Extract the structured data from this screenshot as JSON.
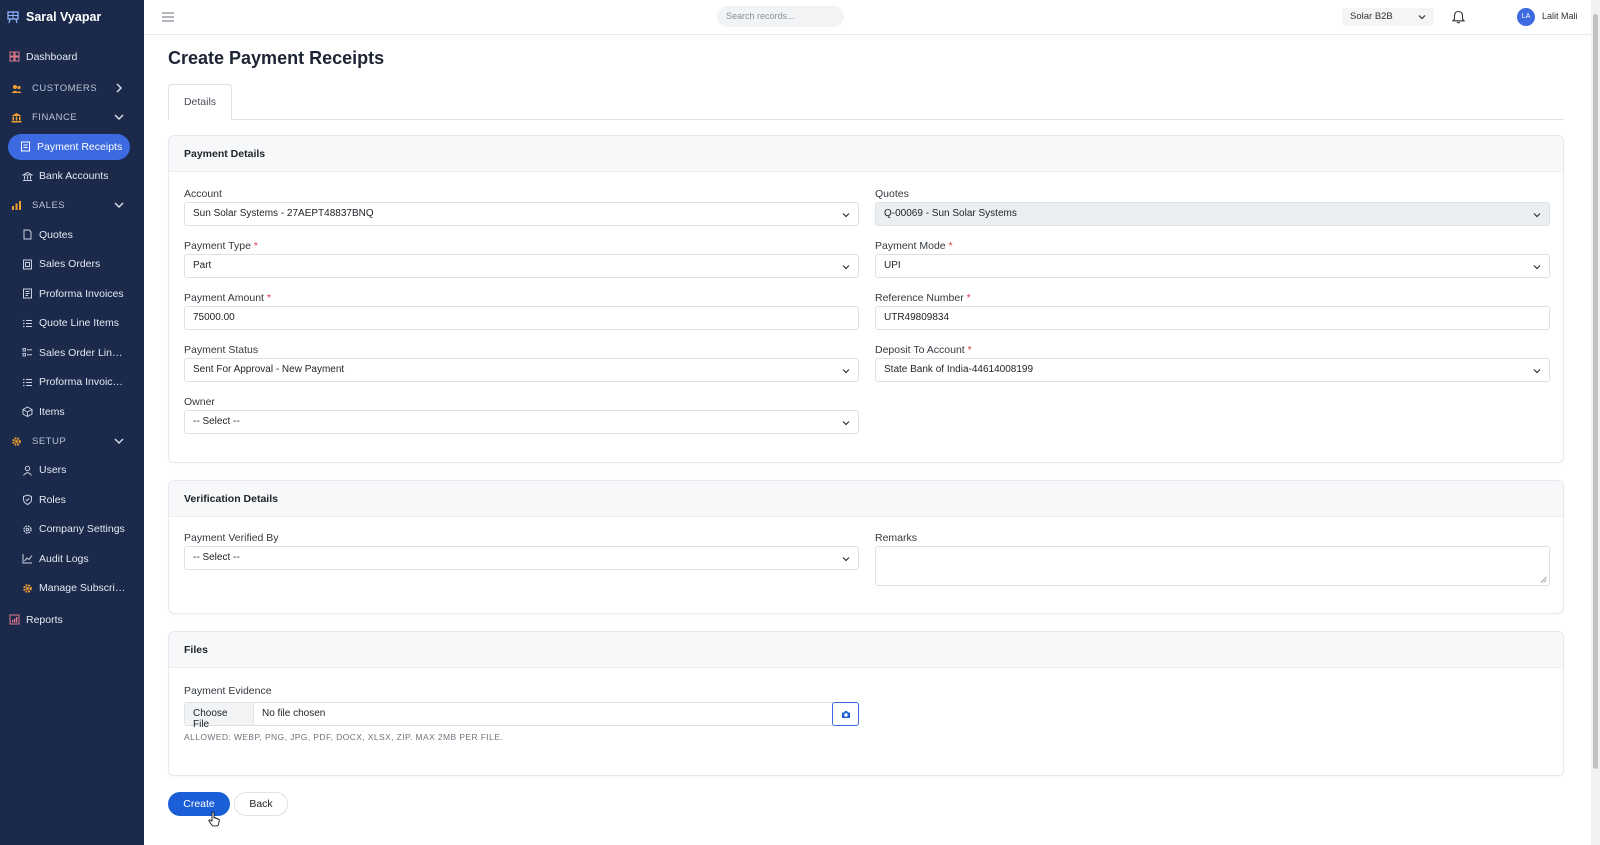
{
  "app": {
    "name": "Saral Vyapar"
  },
  "sidebar": {
    "dashboard": "Dashboard",
    "customers": "CUSTOMERS",
    "finance": "FINANCE",
    "finance_items": [
      "Payment Receipts",
      "Bank Accounts"
    ],
    "sales": "SALES",
    "sales_items": [
      "Quotes",
      "Sales Orders",
      "Proforma Invoices",
      "Quote Line Items",
      "Sales Order Line Items",
      "Proforma Invoice Line Items",
      "Items"
    ],
    "setup": "SETUP",
    "setup_items": [
      "Users",
      "Roles",
      "Company Settings",
      "Audit Logs",
      "Manage Subscription"
    ],
    "reports": "Reports",
    "active_item": "Payment Receipts",
    "accent_color": "#3d6ae0"
  },
  "topbar": {
    "search_placeholder": "Search records...",
    "workspace": "Solar B2B",
    "avatar_initials": "LA",
    "user_name": "Lalit Mali"
  },
  "page": {
    "title": "Create Payment Receipts",
    "tab": "Details"
  },
  "payment_details": {
    "heading": "Payment Details",
    "account": {
      "label": "Account",
      "value": "Sun Solar Systems - 27AEPT48837BNQ"
    },
    "quotes": {
      "label": "Quotes",
      "value": "Q-00069 - Sun Solar Systems"
    },
    "payment_type": {
      "label": "Payment Type",
      "value": "Part"
    },
    "payment_mode": {
      "label": "Payment Mode",
      "value": "UPI"
    },
    "payment_amount": {
      "label": "Payment Amount",
      "value": "75000.00"
    },
    "reference_number": {
      "label": "Reference Number",
      "value": "UTR49809834"
    },
    "payment_status": {
      "label": "Payment Status",
      "value": "Sent For Approval - New Payment"
    },
    "deposit_to_account": {
      "label": "Deposit To Account",
      "value": "State Bank of India-44614008199"
    },
    "owner": {
      "label": "Owner",
      "value": "-- Select --"
    }
  },
  "verification_details": {
    "heading": "Verification Details",
    "verified_by": {
      "label": "Payment Verified By",
      "value": "-- Select --"
    },
    "remarks": {
      "label": "Remarks",
      "value": ""
    }
  },
  "files": {
    "heading": "Files",
    "evidence_label": "Payment Evidence",
    "choose_file": "Choose File",
    "file_status": "No file chosen",
    "hint": "ALLOWED: WEBP, PNG, JPG, PDF, DOCX, XLSX, ZIP. MAX 2MB PER FILE."
  },
  "actions": {
    "create": "Create",
    "back": "Back"
  },
  "required_marker": "*",
  "colors": {
    "primary_button": "#1a5fd8",
    "sidebar_bg": "#1b2a4a",
    "required": "#dc3545"
  }
}
